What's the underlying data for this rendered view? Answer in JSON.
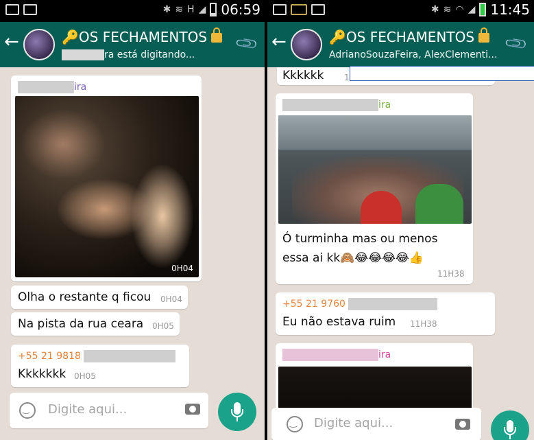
{
  "left": {
    "status_time": "06:59",
    "group_title": "OS FECHAMENTOS",
    "subtitle": "ra está digitando...",
    "messages": [
      {
        "sender_suffix": "ira",
        "photo_time": "0H04"
      },
      {
        "text": "Olha o restante q ficou",
        "time": "0H04"
      },
      {
        "text": "Na pista da rua ceara",
        "time": "0H05"
      },
      {
        "sender": "+55 21 9818",
        "text": "Kkkkkkk",
        "time": "0H05"
      }
    ],
    "input_placeholder": "Digite aqui..."
  },
  "right": {
    "status_time": "11:45",
    "group_title": "OS FECHAMENTOS",
    "subtitle": "AdrianoSouzaFeira, AlexClementi...",
    "messages": [
      {
        "text": "Kkkkkk",
        "time": "11H"
      },
      {
        "sender_suffix": "ira",
        "text": "Ó turminha mas ou menos essa ai kk🙈😂😂😂😂👍",
        "time": "11H38"
      },
      {
        "sender": "+55 21 9760",
        "text": "Eu não estava ruim",
        "time": "11H38"
      },
      {
        "sender_suffix": "ira"
      }
    ],
    "input_placeholder": "Digite aqui..."
  },
  "colors": {
    "header": "#075e54",
    "chat_bg": "#e5ddd5",
    "sender_purple": "#7a5fb0",
    "sender_orange": "#e8843c",
    "sender_green": "#7cb342",
    "sender_pink": "#d6479b",
    "fab": "#1aa38a"
  }
}
